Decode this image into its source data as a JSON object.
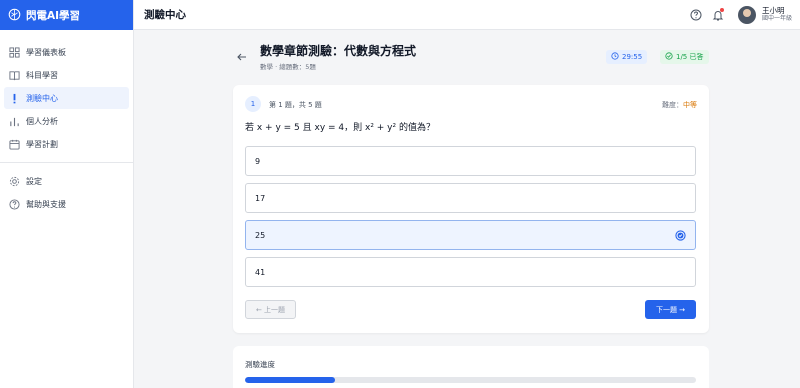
{
  "app": {
    "name": "閃電AI學習"
  },
  "sidebar": {
    "items": [
      {
        "label": "學習儀表板",
        "icon": "dashboard-icon"
      },
      {
        "label": "科目學習",
        "icon": "book-icon"
      },
      {
        "label": "測驗中心",
        "icon": "exclamation-icon",
        "active": true
      },
      {
        "label": "個人分析",
        "icon": "bar-chart-icon"
      },
      {
        "label": "學習計劃",
        "icon": "calendar-icon"
      }
    ],
    "footer_items": [
      {
        "label": "設定",
        "icon": "gear-icon"
      },
      {
        "label": "幫助與支援",
        "icon": "help-icon"
      }
    ]
  },
  "topbar": {
    "title": "測驗中心",
    "user": {
      "name": "王小明",
      "grade": "國中一年級"
    }
  },
  "quiz": {
    "title": "數學章節測驗：代數與方程式",
    "subtitle": "數學 · 總題數：5題",
    "timer": "29:55",
    "answered": "1/5 已答",
    "question_number": "1",
    "question_progress": "第 1 題，共 5 題",
    "difficulty_label": "難度：",
    "difficulty_value": "中等",
    "question_text": "若 x + y = 5 且 xy = 4，則 x² + y² 的值為？",
    "options": [
      "9",
      "17",
      "25",
      "41"
    ],
    "selected_index": 2,
    "prev_label": "← 上一題",
    "next_label": "下一題 →"
  },
  "progress": {
    "label": "測驗進度",
    "fraction": 0.2
  },
  "colors": {
    "accent": "#2563eb",
    "success": "#16a34a",
    "warning": "#d97706"
  }
}
